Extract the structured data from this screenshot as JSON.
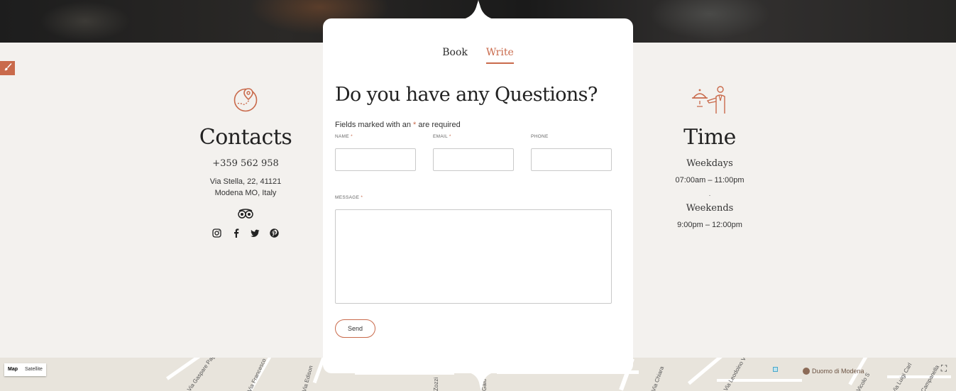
{
  "edit_badge": {
    "icon": "brush-icon"
  },
  "contacts": {
    "icon": "location-map-icon",
    "title": "Contacts",
    "phone": "+359 562 958",
    "address_line1": "Via Stella, 22, 41121",
    "address_line2": "Modena MO, Italy",
    "tripadvisor_icon": "tripadvisor-icon",
    "social": [
      {
        "name": "instagram-icon"
      },
      {
        "name": "facebook-icon"
      },
      {
        "name": "twitter-icon"
      },
      {
        "name": "pinterest-icon"
      }
    ]
  },
  "time": {
    "icon": "waiter-icon",
    "title": "Time",
    "weekdays_label": "Weekdays",
    "weekdays_hours": "07:00am – 11:00pm",
    "separator": ".",
    "weekends_label": "Weekends",
    "weekends_hours": "9:00pm – 12:00pm"
  },
  "form": {
    "tabs": [
      {
        "label": "Book",
        "active": false
      },
      {
        "label": "Write",
        "active": true
      }
    ],
    "heading": "Do you have any Questions?",
    "required_note_prefix": "Fields marked with an ",
    "required_star": "*",
    "required_note_suffix": " are required",
    "name_label": "Name",
    "email_label": "Email",
    "phone_label": "Phone",
    "message_label": "Message",
    "name_value": "",
    "email_value": "",
    "phone_value": "",
    "message_value": "",
    "send_label": "Send"
  },
  "map": {
    "type_map": "Map",
    "type_satellite": "Satellite",
    "poi_label": "Duomo di Modena",
    "streets": [
      "Via Gaspare Pagani",
      "Via Francesco M",
      "Via Edison",
      "Zozzi",
      "Gald",
      "Via Chiara",
      "Via Leodoino Ve",
      "Vicolo S",
      "Via Luigi Carl",
      "Campanella"
    ],
    "fullscreen_icon": "fullscreen-icon"
  },
  "colors": {
    "accent": "#c96a4b",
    "background": "#f3f1ee",
    "card": "#ffffff"
  }
}
